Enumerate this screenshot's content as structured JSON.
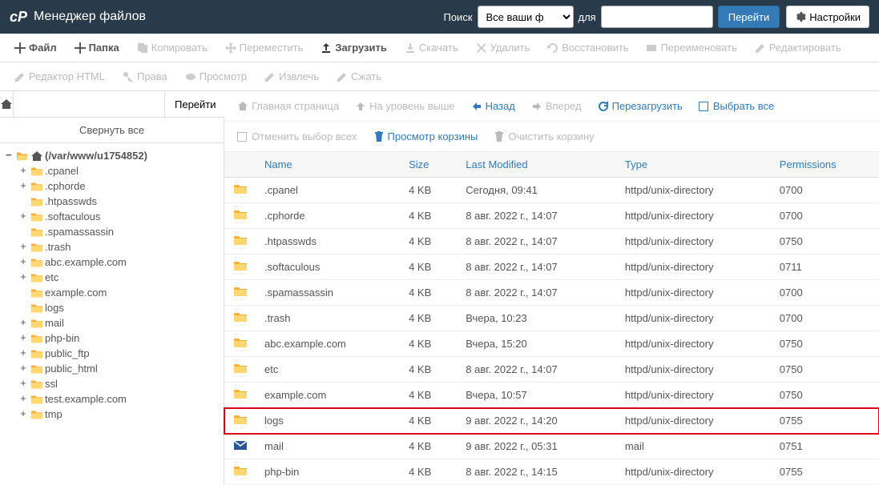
{
  "header": {
    "title": "Менеджер файлов",
    "search_label": "Поиск",
    "search_select": "Все ваши файлы",
    "for_label": "для",
    "go_btn": "Перейти",
    "settings_btn": "Настройки"
  },
  "toolbar": {
    "file": "Файл",
    "folder": "Папка",
    "copy": "Копировать",
    "move": "Переместить",
    "upload": "Загрузить",
    "download": "Скачать",
    "delete": "Удалить",
    "restore": "Восстановить",
    "rename": "Переименовать",
    "edit": "Редактировать",
    "html_editor": "Редактор HTML",
    "permissions": "Права",
    "view": "Просмотр",
    "extract": "Извлечь",
    "compress": "Сжать"
  },
  "sidebar": {
    "go_btn": "Перейти",
    "collapse_all": "Свернуть все",
    "root_label": "(/var/www/u1754852)",
    "tree": [
      {
        "label": ".cpanel",
        "exp": "+"
      },
      {
        "label": ".cphorde",
        "exp": "+"
      },
      {
        "label": ".htpasswds",
        "exp": ""
      },
      {
        "label": ".softaculous",
        "exp": "+"
      },
      {
        "label": ".spamassassin",
        "exp": ""
      },
      {
        "label": ".trash",
        "exp": "+"
      },
      {
        "label": "abc.example.com",
        "exp": "+"
      },
      {
        "label": "etc",
        "exp": "+"
      },
      {
        "label": "example.com",
        "exp": ""
      },
      {
        "label": "logs",
        "exp": ""
      },
      {
        "label": "mail",
        "exp": "+"
      },
      {
        "label": "php-bin",
        "exp": "+"
      },
      {
        "label": "public_ftp",
        "exp": "+"
      },
      {
        "label": "public_html",
        "exp": "+"
      },
      {
        "label": "ssl",
        "exp": "+"
      },
      {
        "label": "test.example.com",
        "exp": "+"
      },
      {
        "label": "tmp",
        "exp": "+"
      }
    ]
  },
  "nav": {
    "home": "Главная страница",
    "up": "На уровень выше",
    "back": "Назад",
    "forward": "Вперед",
    "reload": "Перезагрузить",
    "select_all": "Выбрать все",
    "deselect_all": "Отменить выбор всех",
    "view_trash": "Просмотр корзины",
    "empty_trash": "Очистить корзину"
  },
  "table": {
    "headers": {
      "name": "Name",
      "size": "Size",
      "modified": "Last Modified",
      "type": "Type",
      "perm": "Permissions"
    },
    "rows": [
      {
        "name": ".cpanel",
        "size": "4 KB",
        "modified": "Сегодня, 09:41",
        "type": "httpd/unix-directory",
        "perm": "0700",
        "icon": "folder"
      },
      {
        "name": ".cphorde",
        "size": "4 KB",
        "modified": "8 авг. 2022 г., 14:07",
        "type": "httpd/unix-directory",
        "perm": "0700",
        "icon": "folder"
      },
      {
        "name": ".htpasswds",
        "size": "4 KB",
        "modified": "8 авг. 2022 г., 14:07",
        "type": "httpd/unix-directory",
        "perm": "0750",
        "icon": "folder"
      },
      {
        "name": ".softaculous",
        "size": "4 KB",
        "modified": "8 авг. 2022 г., 14:07",
        "type": "httpd/unix-directory",
        "perm": "0711",
        "icon": "folder"
      },
      {
        "name": ".spamassassin",
        "size": "4 KB",
        "modified": "8 авг. 2022 г., 14:07",
        "type": "httpd/unix-directory",
        "perm": "0700",
        "icon": "folder"
      },
      {
        "name": ".trash",
        "size": "4 KB",
        "modified": "Вчера, 10:23",
        "type": "httpd/unix-directory",
        "perm": "0700",
        "icon": "folder"
      },
      {
        "name": "abc.example.com",
        "size": "4 KB",
        "modified": "Вчера, 15:20",
        "type": "httpd/unix-directory",
        "perm": "0750",
        "icon": "folder"
      },
      {
        "name": "etc",
        "size": "4 KB",
        "modified": "8 авг. 2022 г., 14:07",
        "type": "httpd/unix-directory",
        "perm": "0750",
        "icon": "folder"
      },
      {
        "name": "example.com",
        "size": "4 KB",
        "modified": "Вчера, 10:57",
        "type": "httpd/unix-directory",
        "perm": "0750",
        "icon": "folder"
      },
      {
        "name": "logs",
        "size": "4 KB",
        "modified": "9 авг. 2022 г., 14:20",
        "type": "httpd/unix-directory",
        "perm": "0755",
        "icon": "folder",
        "highlight": true
      },
      {
        "name": "mail",
        "size": "4 KB",
        "modified": "9 авг. 2022 г., 05:31",
        "type": "mail",
        "perm": "0751",
        "icon": "mail"
      },
      {
        "name": "php-bin",
        "size": "4 KB",
        "modified": "8 авг. 2022 г., 14:15",
        "type": "httpd/unix-directory",
        "perm": "0755",
        "icon": "folder"
      }
    ]
  }
}
